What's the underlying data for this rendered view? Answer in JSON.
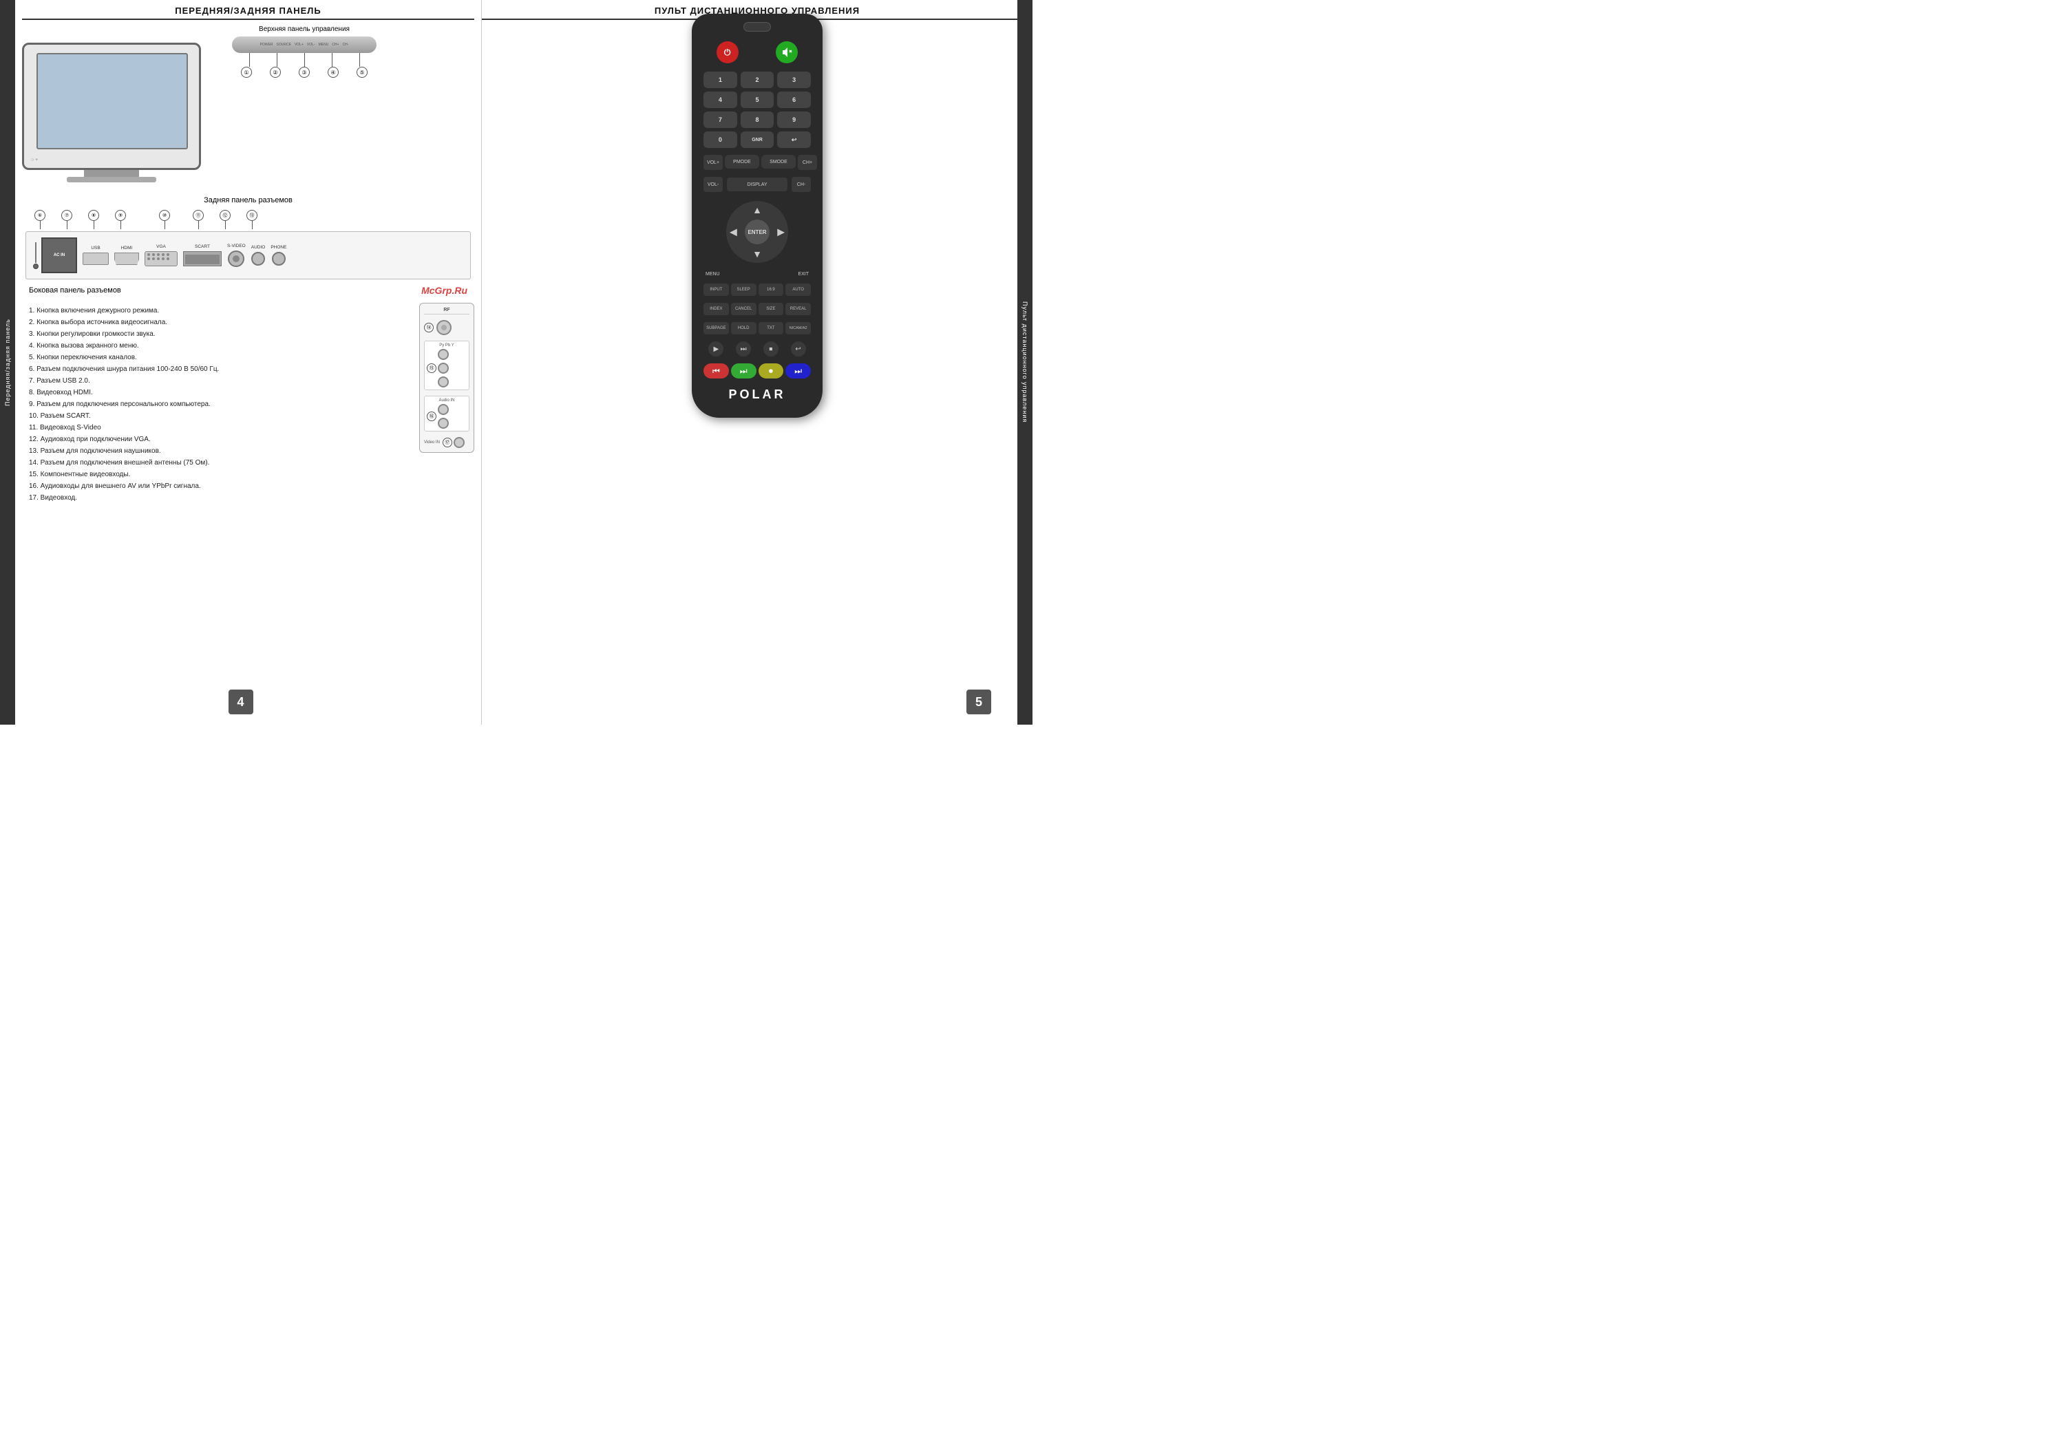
{
  "page": {
    "left_header": "ПЕРЕДНЯЯ/ЗАДНЯЯ ПАНЕЛЬ",
    "right_header": "ПУЛЬТ ДИСТАНЦИОННОГО УПРАВЛЕНИЯ",
    "left_sidebar_label": "Передняя/задняя панель",
    "right_sidebar_label": "Пульт дистанционного управления",
    "page_num_left": "4",
    "page_num_right": "5",
    "watermark": "McGrp.Ru"
  },
  "top_section": {
    "label": "Верхняя панель управления",
    "buttons": [
      "POWER",
      "SOURCE",
      "VOL+",
      "VOL-",
      "MENU",
      "CH+",
      "CH-"
    ],
    "numbers": [
      "①",
      "②",
      "③",
      "④",
      "⑤"
    ]
  },
  "rear_section": {
    "label": "Задняя панель разъемов",
    "connectors": [
      {
        "num": "⑥",
        "label": "AC IN"
      },
      {
        "num": "⑦",
        "label": "USB"
      },
      {
        "num": "⑧",
        "label": "HDMI"
      },
      {
        "num": "⑨",
        "label": "VGA"
      },
      {
        "num": "⑩",
        "label": "SCART"
      },
      {
        "num": "⑪",
        "label": "S-VIDEO"
      },
      {
        "num": "⑫",
        "label": "AUDIO"
      },
      {
        "num": "⑬",
        "label": "PHONE"
      }
    ]
  },
  "side_section": {
    "label": "Боковая панель разъемов",
    "connectors": [
      {
        "num": "⑭",
        "label": "RF"
      },
      {
        "num": "⑮",
        "label": "YPBPR IN"
      },
      {
        "num": "⑯",
        "label": "Audio IN"
      },
      {
        "num": "⑰",
        "label": "Video IN"
      }
    ]
  },
  "description": {
    "items": [
      "1. Кнопка включения дежурного режима.",
      "2. Кнопка выбора источника видеосигнала.",
      "3. Кнопки регулировки громкости звука.",
      "4. Кнопка вызова экранного меню.",
      "5. Кнопки переключения каналов.",
      "6. Разъем подключения шнура питания 100-240 В 50/60 Гц.",
      "7. Разъем USB 2.0.",
      "8. Видеовход HDMI.",
      "9. Разъем для подключения персонального компьютера.",
      "10. Разъем SCART.",
      "11. Видеовход S-Video",
      "12. Аудиовход при подключении VGA.",
      "13. Разъем для подключения наушников.",
      "14. Разъем для подключения внешней антенны (75 Ом).",
      "15. Компонентные видеовходы.",
      "16. Аудиовходы для внешнего AV или YPbPr сигнала.",
      "17. Видеовход."
    ]
  },
  "remote": {
    "brand": "POLAR",
    "power_label": "⏻",
    "input_label": "🔇",
    "numbers": [
      "1",
      "2",
      "3",
      "4",
      "5",
      "6",
      "7",
      "8",
      "9",
      "0",
      "GNR",
      "↩"
    ],
    "special_buttons": [
      "PMODE",
      "SMODE"
    ],
    "vol_up": "VOL+",
    "vol_down": "VOL-",
    "ch_up": "CH+",
    "ch_down": "CH-",
    "display": "DISPLAY",
    "enter": "ENTER",
    "menu": "MENU",
    "exit": "EXIT",
    "function_buttons": [
      "INPUT",
      "SLEEP",
      "16:9",
      "AUTO",
      "INDEX",
      "CANCEL",
      "SIZE",
      "REVEAL",
      "SUBPAGE",
      "HOLD",
      "TXT",
      "NICAM/A2"
    ],
    "media_buttons": [
      "▶",
      "⏭",
      "⏹",
      "↩"
    ],
    "color_buttons": [
      "◀◀",
      "▶▶",
      "🟡",
      "⏭⏭"
    ]
  }
}
